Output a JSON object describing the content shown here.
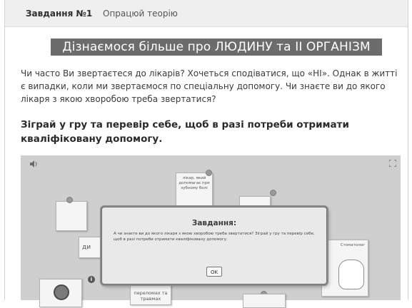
{
  "task": {
    "title": "Завдання №1",
    "subtitle": "Опрацюй теорію"
  },
  "banner": "Дізнаємося більше про ЛЮДИНУ та ІІ ОРГАНІЗМ",
  "intro": "Чи часто Ви звертаєтеся до лікарів? Хочеться сподіватися, що «НІ». Однак в житті є випадки, коли ми звертаємося по спеціальну допомогу. Чи знаєте ви до якого лікаря з якою хворобою треба звертатися?",
  "lead": "Зіграй у гру та перевір себе, щоб в разі потреби отримати кваліфіковану допомогу.",
  "game": {
    "card_top": "лікар, який допомагає при зубному болі",
    "card_left_partial": "ди",
    "card_bottom": "переломах та травмах",
    "card_right_label": "Стоматолог",
    "info_mark": "i"
  },
  "modal": {
    "title": "Завдання:",
    "text": "А чи знаєте ви до якого лікаря з якою хворобою треба звертатися? Зіграй у гру та перевір себе, щоб в разі потреби отримати кваліфіковану допомогу.",
    "ok_label": "OK"
  }
}
